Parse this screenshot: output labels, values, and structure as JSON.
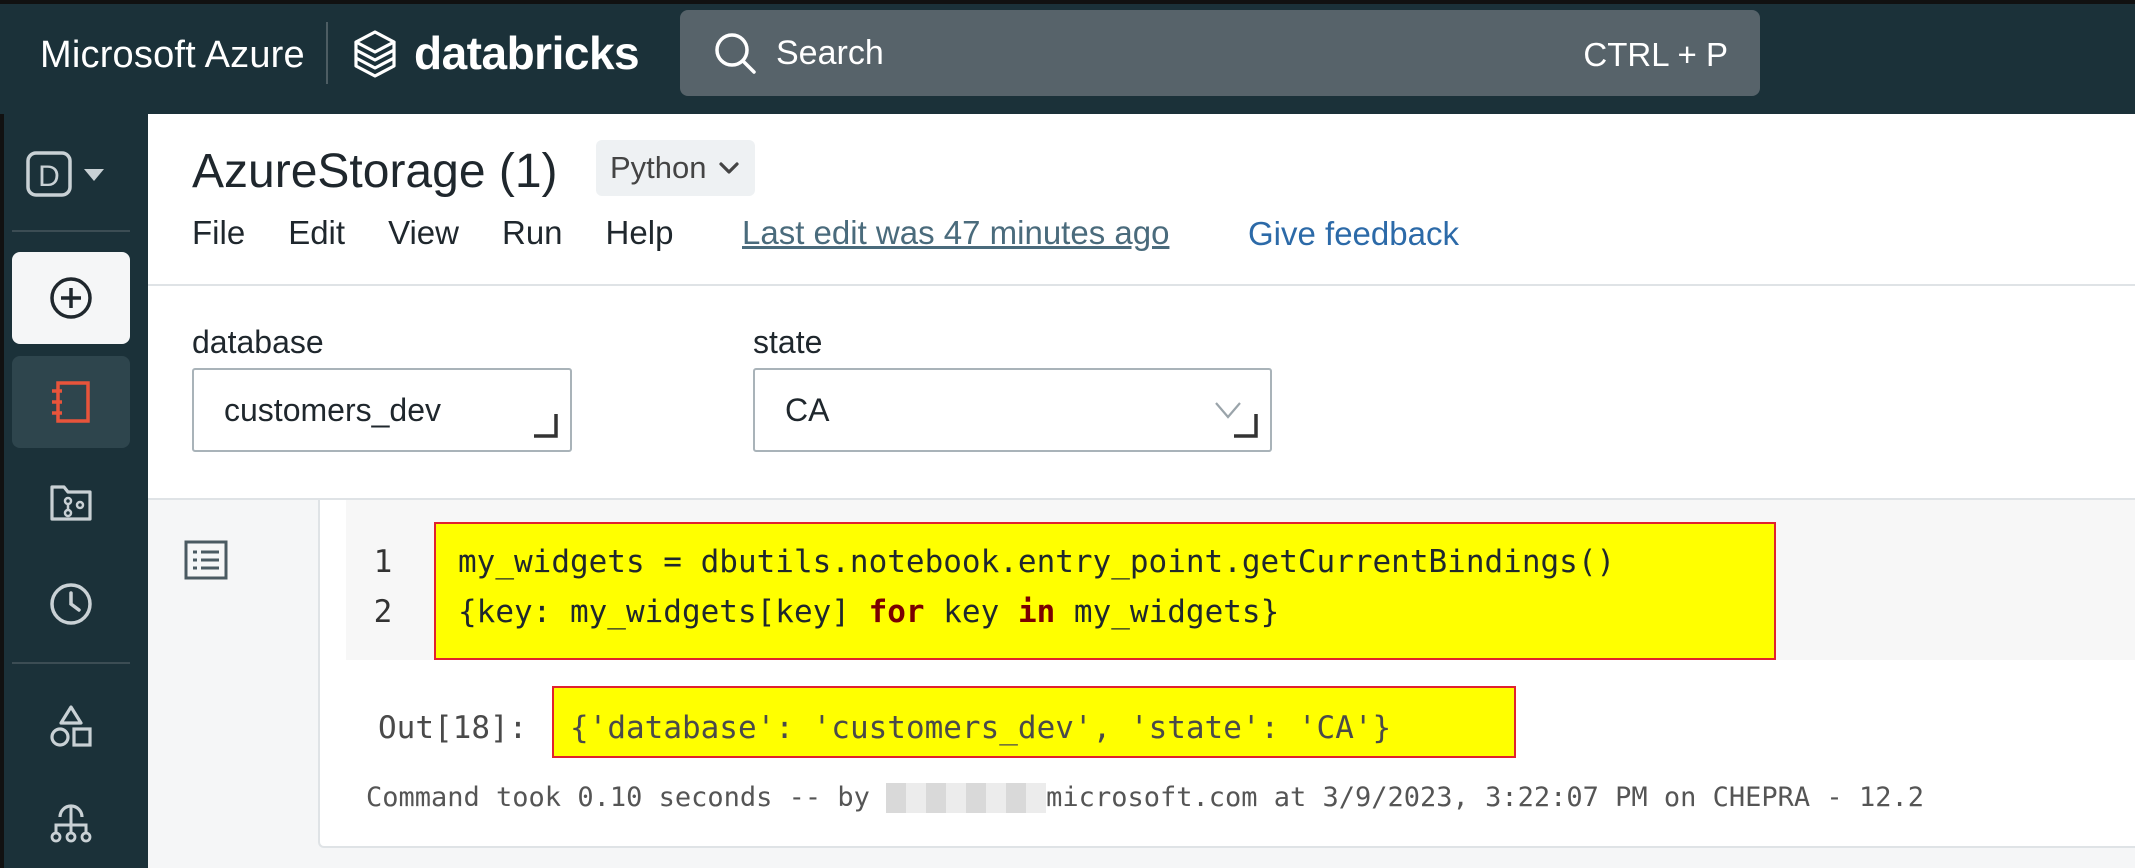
{
  "topbar": {
    "brand_azure": "Microsoft Azure",
    "brand_databricks": "databricks",
    "search_placeholder": "Search",
    "search_shortcut": "CTRL + P"
  },
  "rail": {
    "workspace_letter": "D",
    "items": [
      "new-icon",
      "notebook-icon",
      "repos-icon",
      "recents-icon",
      "catalog-icon",
      "workflows-icon"
    ]
  },
  "header": {
    "notebook_title": "AzureStorage (1)",
    "language": "Python",
    "menu": [
      "File",
      "Edit",
      "View",
      "Run",
      "Help"
    ],
    "last_edit": "Last edit was 47 minutes ago",
    "feedback": "Give feedback"
  },
  "widgets": [
    {
      "label": "database",
      "value": "customers_dev"
    },
    {
      "label": "state",
      "value": "CA"
    }
  ],
  "cell": {
    "line_numbers": [
      "1",
      "2"
    ],
    "line1": "my_widgets = dbutils.notebook.entry_point.getCurrentBindings()",
    "line2_a": "{key: my_widgets[key] ",
    "line2_kw1": "for",
    "line2_b": " key ",
    "line2_kw2": "in",
    "line2_c": " my_widgets}",
    "out_prefix": "Out[18]:",
    "out_value": "{'database': 'customers_dev', 'state': 'CA'}",
    "footer_prefix": "Command took 0.10 seconds -- by ",
    "footer_suffix": "microsoft.com at 3/9/2023, 3:22:07 PM on CHEPRA - 12.2"
  },
  "colors": {
    "topbar_bg": "#1b3139",
    "highlight": "#ffff00",
    "highlight_border": "#e0232e",
    "keyword": "#7a0000",
    "accent_red": "#e8543b"
  }
}
